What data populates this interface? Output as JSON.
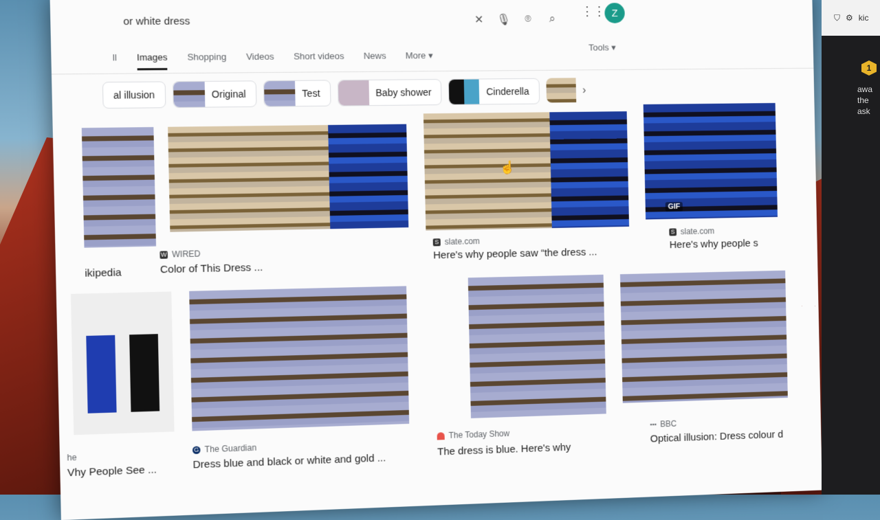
{
  "search": {
    "query": "or white dress"
  },
  "header": {
    "avatar_letter": "Z"
  },
  "tabs": [
    {
      "label": "All",
      "visible": "ll"
    },
    {
      "label": "Images"
    },
    {
      "label": "Shopping"
    },
    {
      "label": "Videos"
    },
    {
      "label": "Short videos"
    },
    {
      "label": "News"
    },
    {
      "label": "More"
    }
  ],
  "tools_label": "Tools",
  "chips": [
    {
      "label": "al illusion"
    },
    {
      "label": "Original"
    },
    {
      "label": "Test"
    },
    {
      "label": "Baby shower"
    },
    {
      "label": "Cinderella"
    }
  ],
  "results_row1": [
    {
      "source": "",
      "title": "ikipedia"
    },
    {
      "source": "WIRED",
      "title": "Color of This Dress ..."
    },
    {
      "source": "slate.com",
      "title": "Here's why people saw “the dress ..."
    },
    {
      "source": "slate.com",
      "title": "Here's why people s",
      "badge": "GIF"
    }
  ],
  "results_row2": [
    {
      "source": "he",
      "title": "Vhy People See ..."
    },
    {
      "source": "The Guardian",
      "title": "Dress blue and black or white and gold ..."
    },
    {
      "source": "The Today Show",
      "title": "The dress is blue. Here's why"
    },
    {
      "source": "BBC",
      "title": "Optical illusion: Dress colour d"
    }
  ],
  "side_window": {
    "tab_text": "kic",
    "badge": "1",
    "lines": [
      "awa",
      "the",
      "ask"
    ]
  },
  "colors": {
    "avatar": "#1a9b8a",
    "guardian": "#052962",
    "today": "#e8534a"
  }
}
